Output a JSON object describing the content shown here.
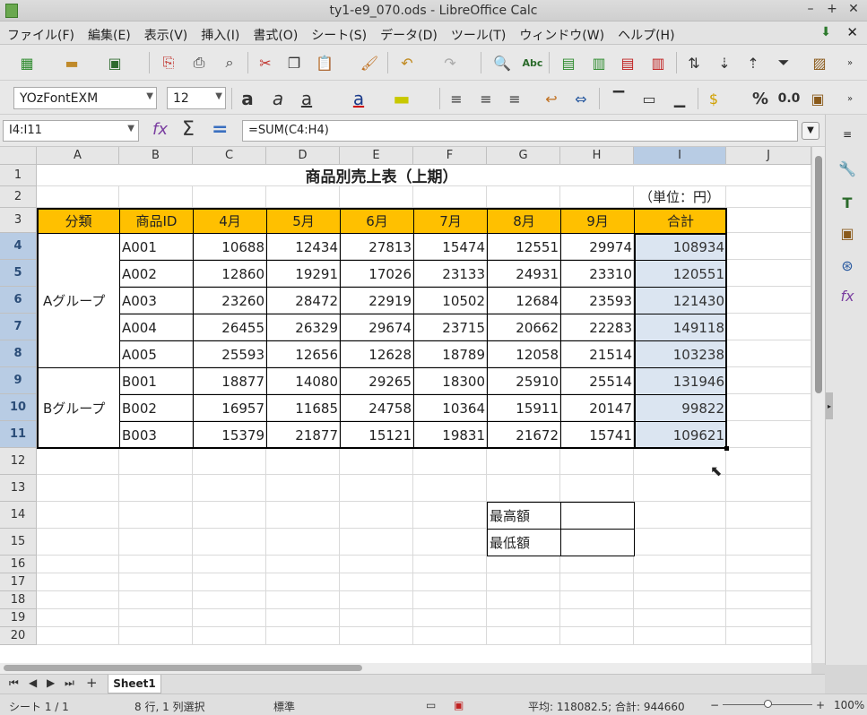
{
  "window": {
    "title": "ty1-e9_070.ods - LibreOffice Calc"
  },
  "menu": [
    "ファイル(F)",
    "編集(E)",
    "表示(V)",
    "挿入(I)",
    "書式(O)",
    "シート(S)",
    "データ(D)",
    "ツール(T)",
    "ウィンドウ(W)",
    "ヘルプ(H)"
  ],
  "format": {
    "font_name": "YOzFontEXM",
    "font_size": "12",
    "percent": "%",
    "decimal": "0.0"
  },
  "formula_bar": {
    "cell_ref": "I4:I11",
    "formula": "=SUM(C4:H4)"
  },
  "columns": [
    "A",
    "B",
    "C",
    "D",
    "E",
    "F",
    "G",
    "H",
    "I",
    "J"
  ],
  "rows": [
    "1",
    "2",
    "3",
    "4",
    "5",
    "6",
    "7",
    "8",
    "9",
    "10",
    "11",
    "12",
    "13",
    "14",
    "15",
    "16",
    "17",
    "18",
    "19",
    "20"
  ],
  "sheet": {
    "title": "商品別売上表（上期）",
    "unit": "（単位：円）",
    "headers": [
      "分類",
      "商品ID",
      "4月",
      "5月",
      "6月",
      "7月",
      "8月",
      "9月",
      "合計"
    ],
    "group_a": "Aグループ",
    "group_b": "Bグループ",
    "data_rows": [
      [
        "A001",
        "10688",
        "12434",
        "27813",
        "15474",
        "12551",
        "29974",
        "108934"
      ],
      [
        "A002",
        "12860",
        "19291",
        "17026",
        "23133",
        "24931",
        "23310",
        "120551"
      ],
      [
        "A003",
        "23260",
        "28472",
        "22919",
        "10502",
        "12684",
        "23593",
        "121430"
      ],
      [
        "A004",
        "26455",
        "26329",
        "29674",
        "23715",
        "20662",
        "22283",
        "149118"
      ],
      [
        "A005",
        "25593",
        "12656",
        "12628",
        "18789",
        "12058",
        "21514",
        "103238"
      ],
      [
        "B001",
        "18877",
        "14080",
        "29265",
        "18300",
        "25910",
        "25514",
        "131946"
      ],
      [
        "B002",
        "16957",
        "11685",
        "24758",
        "10364",
        "15911",
        "20147",
        "99822"
      ],
      [
        "B003",
        "15379",
        "21877",
        "15121",
        "19831",
        "21672",
        "15741",
        "109621"
      ]
    ],
    "max_label": "最高額",
    "min_label": "最低額"
  },
  "tabs": {
    "sheet1": "Sheet1"
  },
  "status": {
    "sheet": "シート 1 / 1",
    "selection": "8 行, 1 列選択",
    "style": "標準",
    "summary": "平均: 118082.5; 合計: 944660",
    "zoom": "100%"
  }
}
